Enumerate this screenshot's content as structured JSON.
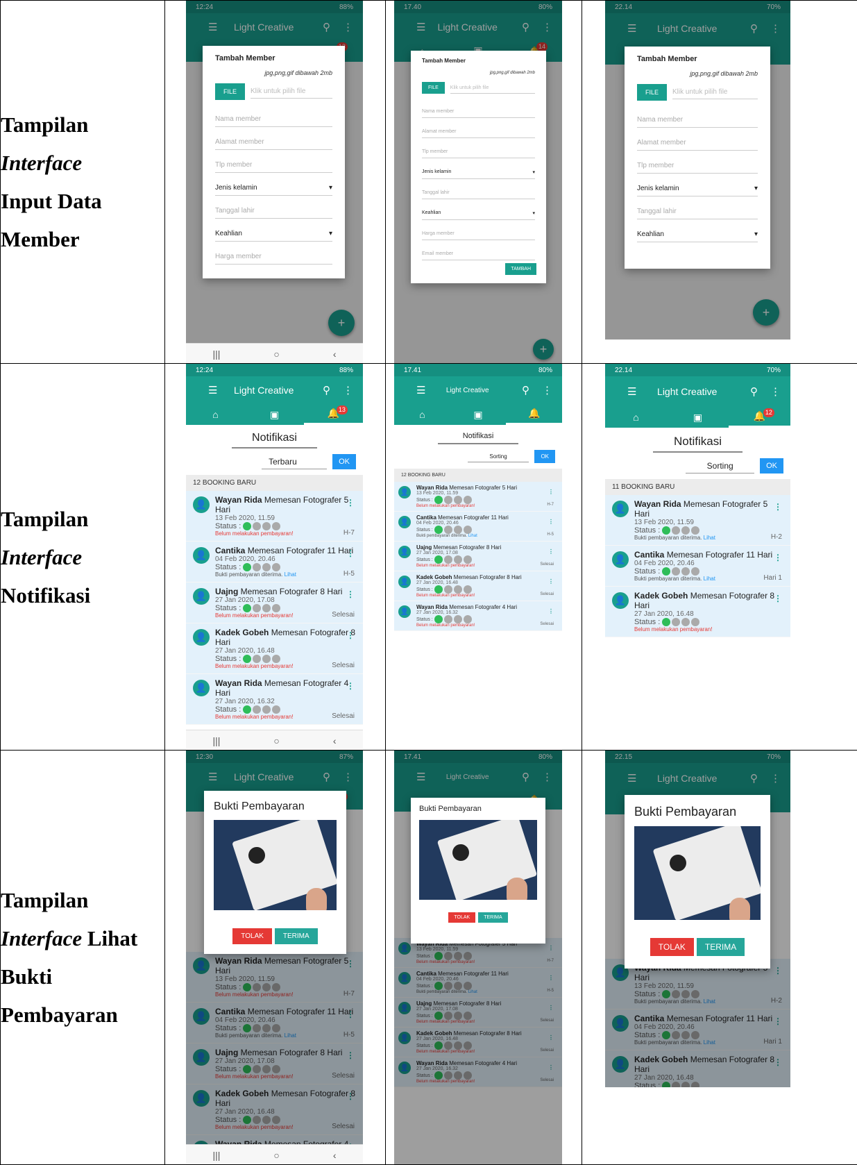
{
  "rows": [
    {
      "label_parts": [
        "Tampilan",
        "Interface",
        "Input Data",
        "Member"
      ]
    },
    {
      "label_parts": [
        "Tampilan",
        "Interface",
        "Notifikasi"
      ]
    },
    {
      "label_parts": [
        "Tampilan",
        "Interface",
        " Lihat",
        "Bukti",
        "Pembayaran"
      ]
    }
  ],
  "app": {
    "title": "Light Creative",
    "badge_a": "13",
    "badge_b": "14",
    "badge_c": "12"
  },
  "status": {
    "p1": {
      "time": "12:24",
      "right": "88%"
    },
    "p2": {
      "time": "17.40",
      "right": "80%"
    },
    "p3": {
      "time": "22.14",
      "right": "70%"
    },
    "p4": {
      "time": "12:24",
      "right": "88%"
    },
    "p5": {
      "time": "17.41",
      "right": "80%"
    },
    "p6": {
      "time": "22.14",
      "right": "70%"
    },
    "p7": {
      "time": "12:30",
      "right": "87%"
    },
    "p8": {
      "time": "17.41",
      "right": "80%"
    },
    "p9": {
      "time": "22.15",
      "right": "70%"
    }
  },
  "form": {
    "title": "Tambah Member",
    "hint": "jpg,png,gif dibawah 2mb",
    "file_btn": "FILE",
    "file_ph": "Klik untuk pilih file",
    "nama": "Nama member",
    "alamat": "Alamat member",
    "tlp": "Tlp member",
    "jenis": "Jenis kelamin",
    "tanggal": "Tanggal lahir",
    "keahlian": "Keahlian",
    "harga": "Harga member",
    "email": "Email member",
    "tambah": "TAMBAH"
  },
  "notif": {
    "title": "Notifikasi",
    "sort_a": "Terbaru",
    "sort_b": "Sorting",
    "ok": "OK",
    "count_12": "12 BOOKING BARU",
    "count_11": "11 BOOKING BARU",
    "status_label": "Status :",
    "unpaid": "Belum melakukan pembayaran!",
    "paid": "Bukti pembayaran diterima.",
    "lihat": "Lihat",
    "items": [
      {
        "name": "Wayan Rida",
        "msg": " Memesan Fotografer 5 Hari",
        "date": "13 Feb 2020, 11.59",
        "tag": "H-7",
        "paid": false
      },
      {
        "name": "Cantika",
        "msg": " Memesan Fotografer 11 Hari",
        "date": "04 Feb 2020, 20.46",
        "tag": "H-5",
        "paid": true
      },
      {
        "name": "Uajng",
        "msg": " Memesan Fotografer 8 Hari",
        "date": "27 Jan 2020, 17.08",
        "tag": "Selesai",
        "paid": false
      },
      {
        "name": "Kadek Gobeh",
        "msg": " Memesan Fotografer 8 Hari",
        "date": "27 Jan 2020, 16.48",
        "tag": "Selesai",
        "paid": false
      },
      {
        "name": "Wayan Rida",
        "msg": " Memesan Fotografer 4 Hari",
        "date": "27 Jan 2020, 16.32",
        "tag": "Selesai",
        "paid": false
      }
    ],
    "items_b": [
      {
        "name": "Wayan Rida",
        "msg": " Memesan Fotografer 5 Hari",
        "date": "13 Feb 2020, 11.59",
        "tag": "H-2",
        "paid": true
      },
      {
        "name": "Cantika",
        "msg": " Memesan Fotografer 11 Hari",
        "date": "04 Feb 2020, 20.46",
        "tag": "Hari 1",
        "paid": true
      },
      {
        "name": "Kadek Gobeh",
        "msg": " Memesan Fotografer 8 Hari",
        "date": "27 Jan 2020, 16.48",
        "tag": "",
        "paid": false
      }
    ]
  },
  "bukti": {
    "title": "Bukti Pembayaran",
    "tolak": "TOLAK",
    "terima": "TERIMA"
  }
}
